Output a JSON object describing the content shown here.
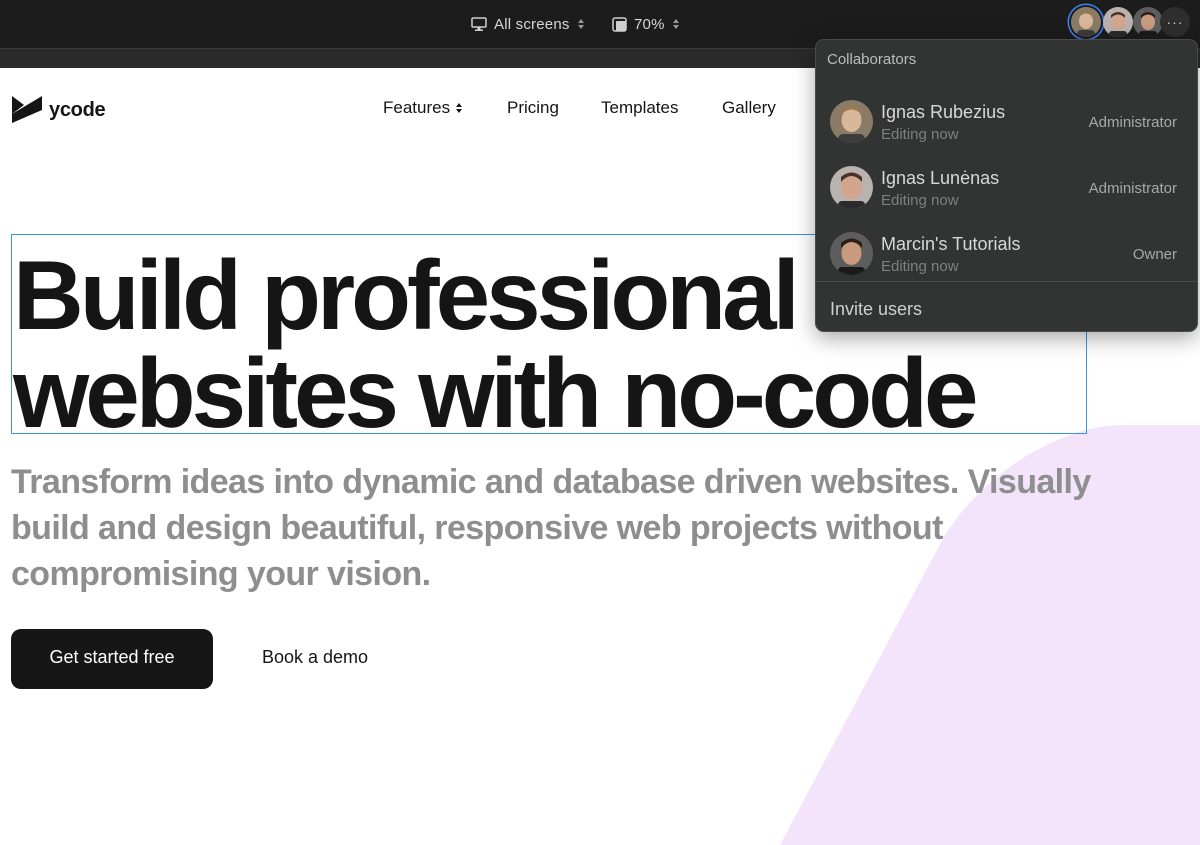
{
  "toolbar": {
    "screens_label": "All screens",
    "zoom_label": "70%",
    "more_label": "···"
  },
  "site": {
    "logo_text": "ycode",
    "nav": [
      {
        "label": "Features"
      },
      {
        "label": "Pricing"
      },
      {
        "label": "Templates"
      },
      {
        "label": "Gallery"
      }
    ],
    "hero_lines": [
      "Build professional",
      "websites with no-code"
    ],
    "sub_lines": [
      "Transform ideas into dynamic and database driven websites. Visually",
      "build and design beautiful, responsive web projects without",
      "compromising your vision."
    ],
    "cta_primary": "Get started free",
    "cta_secondary": "Book a demo"
  },
  "collaborators": {
    "title": "Collaborators",
    "users": [
      {
        "name": "Ignas Rubezius",
        "status": "Editing now",
        "role": "Administrator"
      },
      {
        "name": "Ignas Lunėnas",
        "status": "Editing now",
        "role": "Administrator"
      },
      {
        "name": "Marcin's Tutorials",
        "status": "Editing now",
        "role": "Owner"
      }
    ],
    "invite_label": "Invite users"
  },
  "colors": {
    "toolbar_bg": "#1c1c1c",
    "popover_bg": "#323333",
    "selection": "#3b97dd",
    "accent_pink": "#f3e3fb",
    "active_avatar_ring": "#3b82f6"
  },
  "icons": [
    "monitor-icon",
    "zoom-icon",
    "more-icon",
    "ycode-logo-icon",
    "chevron-updown-icon"
  ]
}
